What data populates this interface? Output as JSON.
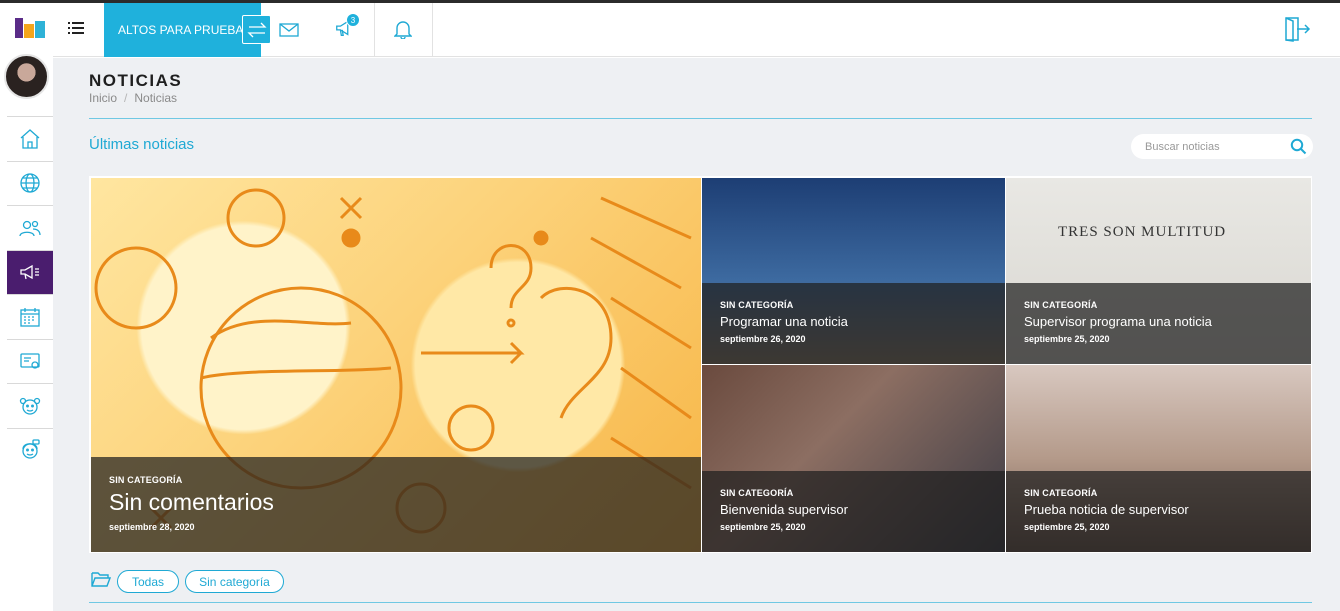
{
  "header": {
    "company": "ALTOS PARA PRUEBA",
    "notifications_count": "3"
  },
  "page": {
    "title": "NOTICIAS",
    "breadcrumb": [
      "Inicio",
      "Noticias"
    ]
  },
  "news": {
    "section_title": "Últimas noticias",
    "search_placeholder": "Buscar noticias",
    "items": [
      {
        "category": "SIN CATEGORÍA",
        "title": "Sin comentarios",
        "date": "septiembre 28, 2020"
      },
      {
        "category": "SIN CATEGORÍA",
        "title": "Programar una noticia",
        "date": "septiembre 26, 2020"
      },
      {
        "category": "SIN CATEGORÍA",
        "title": "Supervisor programa una noticia",
        "date": "septiembre 25, 2020"
      },
      {
        "category": "SIN CATEGORÍA",
        "title": "Bienvenida supervisor",
        "date": "septiembre 25, 2020"
      },
      {
        "category": "SIN CATEGORÍA",
        "title": "Prueba noticia de supervisor",
        "date": "septiembre 25, 2020"
      }
    ],
    "book_text": "TRES SON MULTITUD"
  },
  "filters": {
    "items": [
      "Todas",
      "Sin categoría"
    ]
  },
  "colors": {
    "accent": "#1fb1dc",
    "sidebar_active": "#4a1d6e"
  },
  "icons": {
    "sidebar": [
      "home-icon",
      "globe-icon",
      "users-icon",
      "megaphone-icon",
      "calendar-icon",
      "id-card-icon",
      "child-face-icon",
      "agent-face-icon"
    ]
  }
}
